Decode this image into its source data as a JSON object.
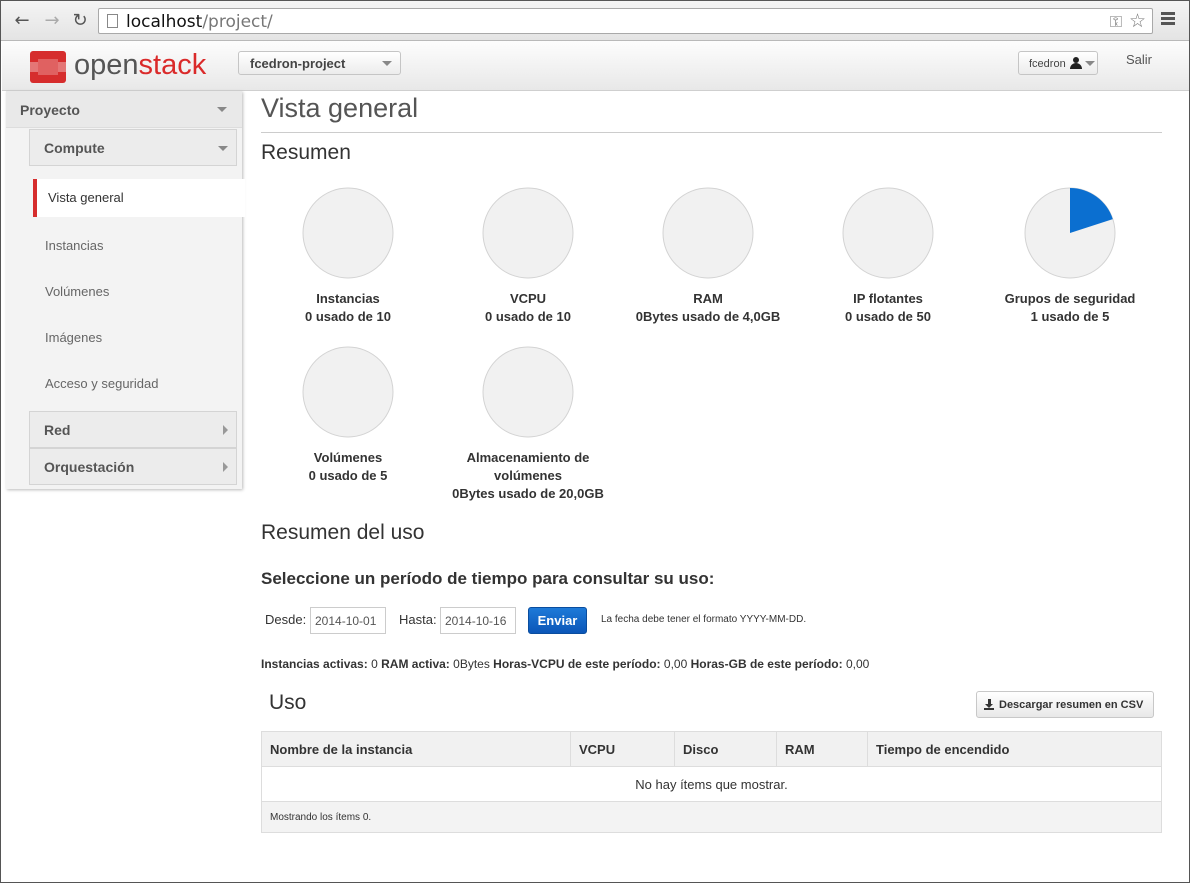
{
  "browser": {
    "url_host": "localhost",
    "url_path": "/project/"
  },
  "header": {
    "logo_part1": "open",
    "logo_part2": "stack",
    "project_selector": "fcedron-project",
    "user_selector": "fcedron",
    "logout": "Salir"
  },
  "sidebar": {
    "dashboard": "Proyecto",
    "panel_compute": "Compute",
    "items": [
      "Vista general",
      "Instancias",
      "Volúmenes",
      "Imágenes",
      "Acceso y seguridad"
    ],
    "panel_red": "Red",
    "panel_orquestacion": "Orquestación"
  },
  "main": {
    "title": "Vista general",
    "summary_heading": "Resumen",
    "limits": [
      {
        "name": "Instancias",
        "value": "0 usado de 10",
        "used": 0,
        "total": 10
      },
      {
        "name": "VCPU",
        "value": "0 usado de 10",
        "used": 0,
        "total": 10
      },
      {
        "name": "RAM",
        "value": "0Bytes usado de 4,0GB",
        "used": 0,
        "total": 4
      },
      {
        "name": "IP flotantes",
        "value": "0 usado de 50",
        "used": 0,
        "total": 50
      },
      {
        "name": "Grupos de seguridad",
        "value": "1 usado de 5",
        "used": 1,
        "total": 5
      },
      {
        "name": "Volúmenes",
        "value": "0 usado de 5",
        "used": 0,
        "total": 5
      },
      {
        "name": "Almacenamiento de volúmenes",
        "value": "0Bytes usado de 20,0GB",
        "used": 0,
        "total": 20
      }
    ],
    "usage_summary_heading": "Resumen del uso",
    "period_heading": "Seleccione un período de tiempo para consultar su uso:",
    "form": {
      "from_label": "Desde:",
      "from_value": "2014-10-01",
      "to_label": "Hasta:",
      "to_value": "2014-10-16",
      "submit": "Enviar",
      "help": "La fecha debe tener el formato YYYY-MM-DD."
    },
    "stats": {
      "active_instances_label": "Instancias activas:",
      "active_instances_value": "0",
      "active_ram_label": "RAM activa:",
      "active_ram_value": "0Bytes",
      "vcpu_hours_label": "Horas-VCPU de este período:",
      "vcpu_hours_value": "0,00",
      "gb_hours_label": "Horas-GB de este período:",
      "gb_hours_value": "0,00"
    },
    "usage_heading": "Uso",
    "csv_button": "Descargar resumen en CSV",
    "table": {
      "columns": [
        "Nombre de la instancia",
        "VCPU",
        "Disco",
        "RAM",
        "Tiempo de encendido"
      ],
      "empty_message": "No hay ítems que mostrar.",
      "footer": "Mostrando los ítems 0."
    }
  },
  "colors": {
    "accent_red": "#d62d2d",
    "primary_blue": "#0b62c8",
    "pie_used": "#0b6fd0",
    "pie_bg": "#f1f1f1"
  }
}
